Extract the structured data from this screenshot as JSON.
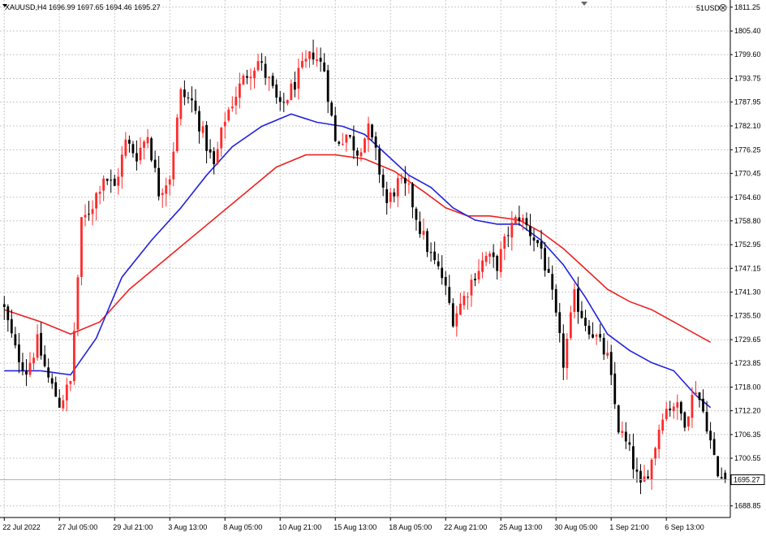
{
  "header": {
    "symbol_info": "XAUUSD,H4  1696.99 1697.65 1694.46 1695.27",
    "account_label": "51USD"
  },
  "colors": {
    "bull": "#ff2a2a",
    "bear": "#000000",
    "ma_fast": "#2222dd",
    "ma_slow": "#ee2222",
    "grid": "#c8c8c8",
    "background": "#ffffff"
  },
  "chart_data": {
    "type": "candlestick",
    "symbol": "XAUUSD",
    "timeframe": "H4",
    "last_price": 1695.27,
    "last_price_label": "1695.27",
    "ylim": [
      1686.0,
      1813.0
    ],
    "y_ticks": [
      "1811.25",
      "1805.40",
      "1799.60",
      "1793.75",
      "1787.95",
      "1782.10",
      "1776.25",
      "1770.45",
      "1764.60",
      "1758.80",
      "1752.95",
      "1747.15",
      "1741.30",
      "1735.50",
      "1729.65",
      "1723.85",
      "1718.00",
      "1712.20",
      "1706.35",
      "1700.55",
      "1688.85"
    ],
    "x_ticks": [
      {
        "label": "22 Jul 2022",
        "i": 0
      },
      {
        "label": "27 Jul 05:00",
        "i": 15
      },
      {
        "label": "29 Jul 21:00",
        "i": 30
      },
      {
        "label": "3 Aug 13:00",
        "i": 45
      },
      {
        "label": "8 Aug 05:00",
        "i": 60
      },
      {
        "label": "10 Aug 21:00",
        "i": 75
      },
      {
        "label": "15 Aug 13:00",
        "i": 90
      },
      {
        "label": "18 Aug 05:00",
        "i": 105
      },
      {
        "label": "22 Aug 21:00",
        "i": 120
      },
      {
        "label": "25 Aug 13:00",
        "i": 135
      },
      {
        "label": "30 Aug 05:00",
        "i": 150
      },
      {
        "label": "1 Sep 21:00",
        "i": 165
      },
      {
        "label": "6 Sep 13:00",
        "i": 180
      }
    ],
    "close_path": [
      [
        0,
        1737
      ],
      [
        3,
        1727
      ],
      [
        6,
        1722
      ],
      [
        9,
        1729
      ],
      [
        12,
        1720
      ],
      [
        15,
        1714
      ],
      [
        18,
        1719
      ],
      [
        21,
        1758
      ],
      [
        24,
        1763
      ],
      [
        27,
        1770
      ],
      [
        30,
        1767
      ],
      [
        33,
        1778
      ],
      [
        36,
        1775
      ],
      [
        39,
        1780
      ],
      [
        42,
        1766
      ],
      [
        45,
        1770
      ],
      [
        48,
        1790
      ],
      [
        51,
        1788
      ],
      [
        54,
        1780
      ],
      [
        57,
        1772
      ],
      [
        60,
        1784
      ],
      [
        63,
        1790
      ],
      [
        66,
        1795
      ],
      [
        69,
        1798
      ],
      [
        72,
        1793
      ],
      [
        75,
        1786
      ],
      [
        78,
        1791
      ],
      [
        81,
        1796
      ],
      [
        84,
        1800
      ],
      [
        87,
        1796
      ],
      [
        90,
        1778
      ],
      [
        93,
        1780
      ],
      [
        96,
        1776
      ],
      [
        99,
        1781
      ],
      [
        101,
        1775
      ],
      [
        104,
        1763
      ],
      [
        107,
        1768
      ],
      [
        110,
        1766
      ],
      [
        113,
        1757
      ],
      [
        116,
        1750
      ],
      [
        119,
        1745
      ],
      [
        122,
        1735
      ],
      [
        125,
        1740
      ],
      [
        128,
        1746
      ],
      [
        131,
        1750
      ],
      [
        134,
        1748
      ],
      [
        137,
        1756
      ],
      [
        140,
        1760
      ],
      [
        143,
        1756
      ],
      [
        146,
        1752
      ],
      [
        149,
        1740
      ],
      [
        152,
        1724
      ],
      [
        155,
        1740
      ],
      [
        158,
        1734
      ],
      [
        161,
        1730
      ],
      [
        164,
        1725
      ],
      [
        167,
        1708
      ],
      [
        170,
        1702
      ],
      [
        173,
        1693
      ],
      [
        176,
        1700
      ],
      [
        179,
        1712
      ],
      [
        182,
        1714
      ],
      [
        185,
        1710
      ],
      [
        188,
        1718
      ],
      [
        191,
        1709
      ],
      [
        194,
        1696
      ],
      [
        196,
        1695.27
      ]
    ],
    "ma_fast_path": [
      [
        0,
        1722
      ],
      [
        10,
        1722
      ],
      [
        18,
        1721
      ],
      [
        25,
        1730
      ],
      [
        32,
        1745
      ],
      [
        40,
        1754
      ],
      [
        48,
        1762
      ],
      [
        55,
        1770
      ],
      [
        62,
        1777
      ],
      [
        70,
        1782
      ],
      [
        78,
        1785
      ],
      [
        85,
        1783
      ],
      [
        92,
        1782
      ],
      [
        98,
        1780
      ],
      [
        104,
        1775
      ],
      [
        110,
        1770
      ],
      [
        116,
        1767
      ],
      [
        122,
        1762
      ],
      [
        128,
        1759
      ],
      [
        134,
        1758
      ],
      [
        140,
        1758
      ],
      [
        146,
        1754
      ],
      [
        152,
        1748
      ],
      [
        158,
        1740
      ],
      [
        164,
        1731
      ],
      [
        170,
        1727
      ],
      [
        176,
        1724
      ],
      [
        182,
        1722
      ],
      [
        188,
        1716
      ],
      [
        192,
        1713
      ]
    ],
    "ma_slow_path": [
      [
        0,
        1737
      ],
      [
        10,
        1734
      ],
      [
        18,
        1731
      ],
      [
        26,
        1734
      ],
      [
        34,
        1742
      ],
      [
        42,
        1748
      ],
      [
        50,
        1754
      ],
      [
        58,
        1760
      ],
      [
        66,
        1766
      ],
      [
        74,
        1772
      ],
      [
        82,
        1775
      ],
      [
        90,
        1775
      ],
      [
        98,
        1774
      ],
      [
        106,
        1771
      ],
      [
        114,
        1766
      ],
      [
        120,
        1762
      ],
      [
        126,
        1760
      ],
      [
        132,
        1760
      ],
      [
        140,
        1759
      ],
      [
        146,
        1756
      ],
      [
        152,
        1752
      ],
      [
        158,
        1747
      ],
      [
        164,
        1742
      ],
      [
        170,
        1739
      ],
      [
        176,
        1737
      ],
      [
        182,
        1734
      ],
      [
        188,
        1731
      ],
      [
        192,
        1729
      ]
    ],
    "axis_region": {
      "last_index": 196,
      "total_slots": 197
    }
  }
}
